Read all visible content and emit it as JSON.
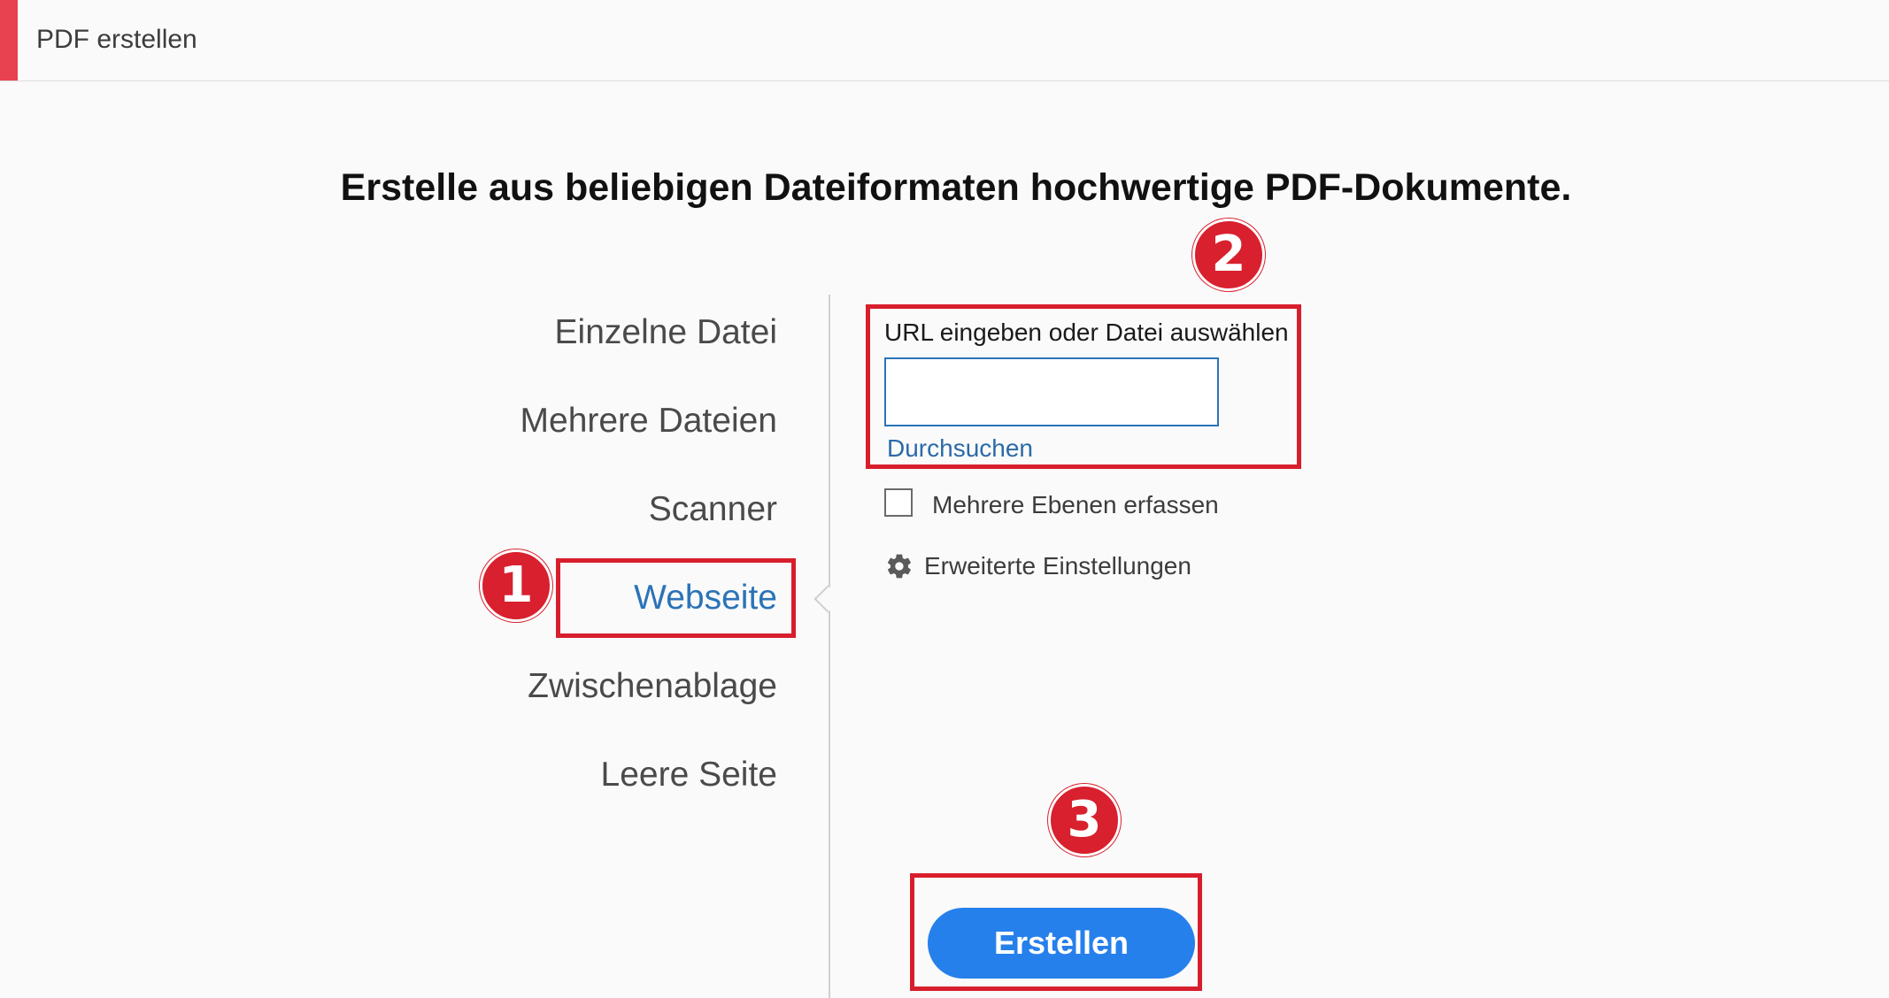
{
  "window": {
    "title": "PDF erstellen",
    "accent_color": "#e8414f"
  },
  "headline": "Erstelle aus beliebigen Dateiformaten hochwertige PDF-Dokumente.",
  "nav": {
    "items": [
      {
        "label": "Einzelne Datei",
        "active": false
      },
      {
        "label": "Mehrere Dateien",
        "active": false
      },
      {
        "label": "Scanner",
        "active": false
      },
      {
        "label": "Webseite",
        "active": true
      },
      {
        "label": "Zwischenablage",
        "active": false
      },
      {
        "label": "Leere Seite",
        "active": false
      }
    ],
    "active_color": "#2b73b8"
  },
  "panel": {
    "field_label": "URL eingeben oder Datei auswählen",
    "url_value": "",
    "browse_label": "Durchsuchen",
    "checkbox_label": "Mehrere Ebenen erfassen",
    "checkbox_checked": false,
    "advanced_label": "Erweiterte Einstellungen",
    "advanced_icon": "gear-icon"
  },
  "action": {
    "create_label": "Erstellen",
    "button_color": "#2680eb"
  },
  "annotations": {
    "color": "#d81e2c",
    "markers": [
      "1",
      "2",
      "3"
    ]
  }
}
